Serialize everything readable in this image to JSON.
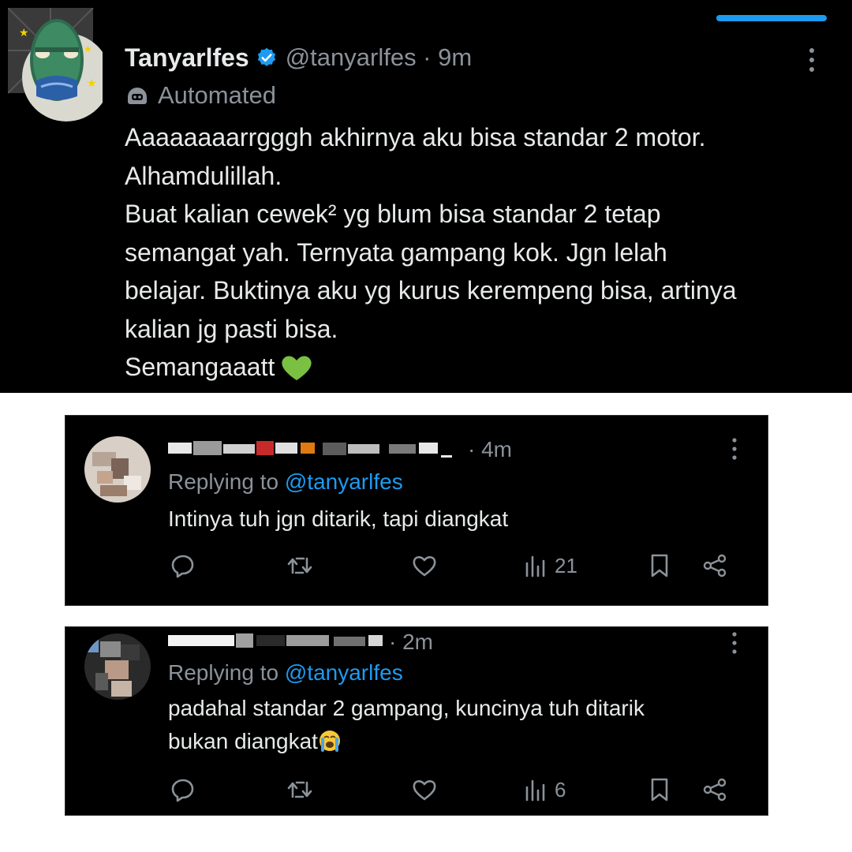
{
  "main_tweet": {
    "display_name": "Tanyarlfes",
    "handle_time": "@tanyarlfes · 9m",
    "automated_label": "Automated",
    "text": "Aaaaaaaarrgggh akhirnya aku bisa standar 2 motor.\nAlhamdulillah.\nBuat kalian cewek² yg blum bisa standar 2 tetap\nsemangat yah. Ternyata gampang kok. Jgn lelah\nbelajar. Buktinya aku yg kurus kerempeng bisa, artinya\nkalian jg pasti bisa.\nSemangaaatt",
    "emoji": "green-heart",
    "accent_color": "#1d9bf0"
  },
  "replies": [
    {
      "time": "· 4m",
      "replying_prefix": "Replying to ",
      "mention": "@tanyarlfes",
      "text": "Intinya tuh jgn ditarik, tapi diangkat",
      "views": "21"
    },
    {
      "time": "· 2m",
      "replying_prefix": "Replying to ",
      "mention": "@tanyarlfes",
      "text": "padahal standar 2 gampang, kuncinya tuh ditarik\nbukan diangkat",
      "emoji": "loudly-crying-face",
      "views": "6"
    }
  ],
  "icons": [
    "reply-icon",
    "retweet-icon",
    "like-icon",
    "views-icon",
    "bookmark-icon",
    "share-icon",
    "more-icon",
    "verified-icon",
    "automated-bot-icon"
  ]
}
